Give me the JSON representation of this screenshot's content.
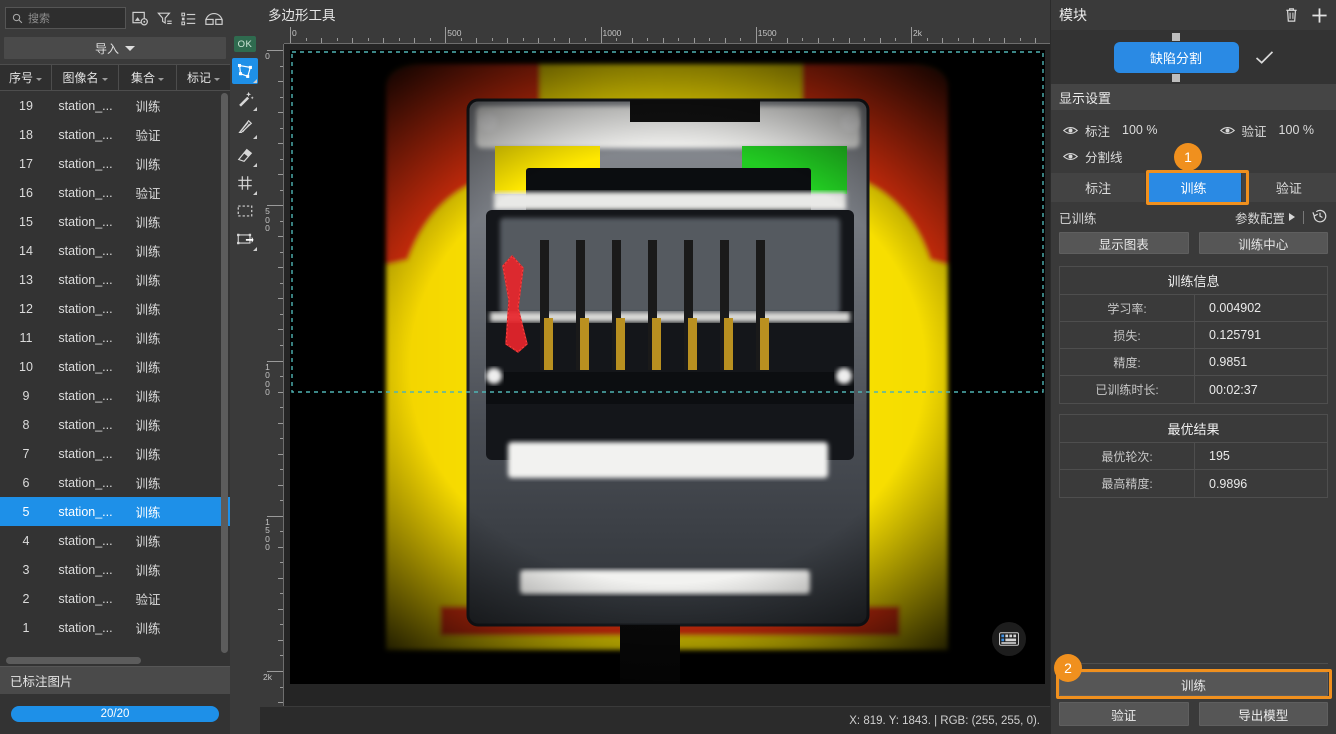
{
  "sidebar": {
    "search": {
      "placeholder": "搜索",
      "icon": "search-icon"
    },
    "toolbar_icons": [
      "image-settings-icon",
      "filter-icon",
      "list-view-icon",
      "panel-layout-icon"
    ],
    "import_button": "导入",
    "columns": [
      "序号",
      "图像名",
      "集合",
      "标记"
    ],
    "rows": [
      {
        "index": "1",
        "name": "station_...",
        "set": "训练",
        "mark": ""
      },
      {
        "index": "2",
        "name": "station_...",
        "set": "验证",
        "mark": ""
      },
      {
        "index": "3",
        "name": "station_...",
        "set": "训练",
        "mark": ""
      },
      {
        "index": "4",
        "name": "station_...",
        "set": "训练",
        "mark": ""
      },
      {
        "index": "5",
        "name": "station_...",
        "set": "训练",
        "mark": ""
      },
      {
        "index": "6",
        "name": "station_...",
        "set": "训练",
        "mark": ""
      },
      {
        "index": "7",
        "name": "station_...",
        "set": "训练",
        "mark": ""
      },
      {
        "index": "8",
        "name": "station_...",
        "set": "训练",
        "mark": ""
      },
      {
        "index": "9",
        "name": "station_...",
        "set": "训练",
        "mark": ""
      },
      {
        "index": "10",
        "name": "station_...",
        "set": "训练",
        "mark": ""
      },
      {
        "index": "11",
        "name": "station_...",
        "set": "训练",
        "mark": ""
      },
      {
        "index": "12",
        "name": "station_...",
        "set": "训练",
        "mark": ""
      },
      {
        "index": "13",
        "name": "station_...",
        "set": "训练",
        "mark": ""
      },
      {
        "index": "14",
        "name": "station_...",
        "set": "训练",
        "mark": ""
      },
      {
        "index": "15",
        "name": "station_...",
        "set": "训练",
        "mark": ""
      },
      {
        "index": "16",
        "name": "station_...",
        "set": "验证",
        "mark": ""
      },
      {
        "index": "17",
        "name": "station_...",
        "set": "训练",
        "mark": ""
      },
      {
        "index": "18",
        "name": "station_...",
        "set": "验证",
        "mark": ""
      },
      {
        "index": "19",
        "name": "station_...",
        "set": "训练",
        "mark": ""
      }
    ],
    "selected_row_index": 4,
    "labeled_header": "已标注图片",
    "progress_text": "20/20",
    "progress_color": "#1e90e8"
  },
  "vtoolbar": {
    "ok_badge": "OK",
    "tools": [
      {
        "name": "polygon-tool",
        "active": true
      },
      {
        "name": "magic-wand-tool",
        "active": false
      },
      {
        "name": "brush-tool",
        "active": false
      },
      {
        "name": "eraser-tool",
        "active": false
      },
      {
        "name": "grid-tool",
        "active": false
      },
      {
        "name": "marquee-select-tool",
        "active": false
      },
      {
        "name": "transform-tool",
        "active": false
      }
    ]
  },
  "canvas": {
    "title": "多边形工具",
    "ruler_h_labels": [
      "0",
      "500",
      "1000",
      "1500",
      "2k"
    ],
    "ruler_v_labels": [
      "0",
      "500",
      "1000",
      "1500",
      "2k"
    ],
    "status": "X: 819. Y: 1843. | RGB: (255, 255, 0).",
    "keyboard_icon": "keyboard-shortcuts-icon",
    "annotation_color": "#e8252b",
    "selection_box_color": "#4fb3b3"
  },
  "right_panel": {
    "title": "模块",
    "header_icons": [
      "trash-icon",
      "plus-icon"
    ],
    "module_chip": "缺陷分割",
    "module_check": "check-icon",
    "display_settings": {
      "header": "显示设置",
      "items": [
        {
          "label": "标注",
          "value": "100 %"
        },
        {
          "label": "验证",
          "value": "100 %"
        },
        {
          "label": "分割线",
          "value": ""
        }
      ]
    },
    "tabs": [
      {
        "label": "标注",
        "active": false
      },
      {
        "label": "训练",
        "active": true
      },
      {
        "label": "验证",
        "active": false
      }
    ],
    "marker_1": "1",
    "marker_2": "2",
    "trained_status": "已训练",
    "param_config": "参数配置",
    "history_icon": "history-icon",
    "buttons": {
      "show_chart": "显示图表",
      "training_center": "训练中心"
    },
    "training_info": {
      "title": "训练信息",
      "rows": [
        {
          "key": "学习率:",
          "value": "0.004902"
        },
        {
          "key": "损失:",
          "value": "0.125791"
        },
        {
          "key": "精度:",
          "value": "0.9851"
        },
        {
          "key": "已训练时长:",
          "value": "00:02:37"
        }
      ]
    },
    "best_result": {
      "title": "最优结果",
      "rows": [
        {
          "key": "最优轮次:",
          "value": "195"
        },
        {
          "key": "最高精度:",
          "value": "0.9896"
        }
      ]
    },
    "actions": {
      "train": "训练",
      "validate": "验证",
      "export": "导出模型"
    },
    "accent_color": "#2a8ae4",
    "marker_color": "#f0901e"
  }
}
